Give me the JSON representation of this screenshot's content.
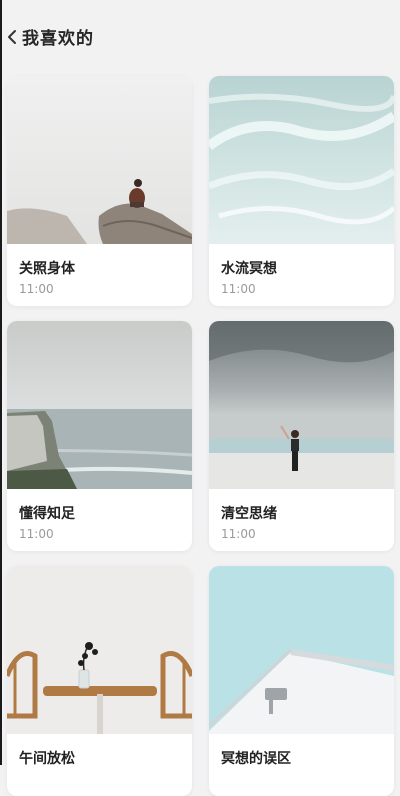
{
  "header": {
    "title": "我喜欢的",
    "back_icon": "chevron-left-icon"
  },
  "items": [
    {
      "name": "关照身体",
      "time": "11:00"
    },
    {
      "name": "水流冥想",
      "time": "11:00"
    },
    {
      "name": "懂得知足",
      "time": "11:00"
    },
    {
      "name": "清空思绪",
      "time": "11:00"
    },
    {
      "name": "午间放松",
      "time": ""
    },
    {
      "name": "冥想的误区",
      "time": ""
    }
  ]
}
